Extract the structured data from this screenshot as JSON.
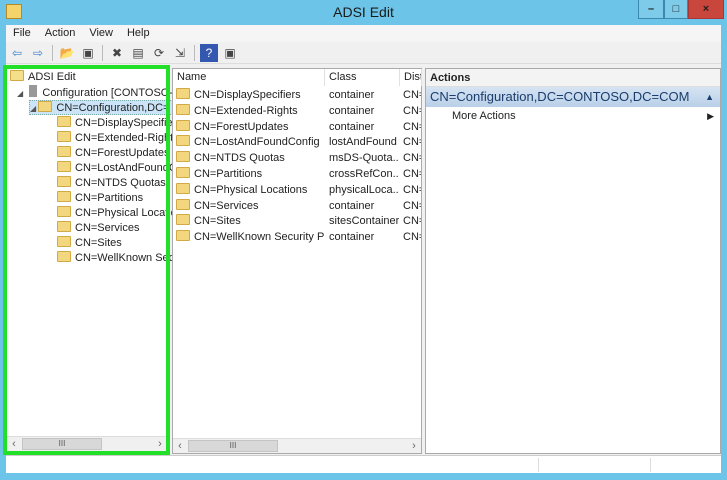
{
  "window": {
    "title": "ADSI Edit",
    "minimize": "–",
    "maximize": "□",
    "close": "×"
  },
  "menu": [
    "File",
    "Action",
    "View",
    "Help"
  ],
  "toolbar": [
    {
      "name": "back-icon",
      "glyph": "⇦"
    },
    {
      "name": "forward-icon",
      "glyph": "⇨"
    },
    {
      "name": "up-folder-icon",
      "glyph": "📂"
    },
    {
      "name": "show-hide-tree-icon",
      "glyph": "▣"
    },
    {
      "name": "delete-icon",
      "glyph": "✖"
    },
    {
      "name": "properties-icon",
      "glyph": "▤"
    },
    {
      "name": "refresh-icon",
      "glyph": "⟳"
    },
    {
      "name": "export-list-icon",
      "glyph": "⇲"
    },
    {
      "name": "help-icon",
      "glyph": "?"
    },
    {
      "name": "show-action-pane-icon",
      "glyph": "▣"
    }
  ],
  "tree": {
    "root": "ADSI Edit",
    "connection": "Configuration [CONTOSO-D",
    "selected": "CN=Configuration,DC=",
    "children": [
      "CN=DisplaySpecifier",
      "CN=Extended-Rights",
      "CN=ForestUpdates",
      "CN=LostAndFoundC",
      "CN=NTDS Quotas",
      "CN=Partitions",
      "CN=Physical Locatio",
      "CN=Services",
      "CN=Sites",
      "CN=WellKnown Secu"
    ]
  },
  "list": {
    "columns": [
      "Name",
      "Class",
      "Disti"
    ],
    "rows": [
      [
        "CN=DisplaySpecifiers",
        "container",
        "CN="
      ],
      [
        "CN=Extended-Rights",
        "container",
        "CN="
      ],
      [
        "CN=ForestUpdates",
        "container",
        "CN="
      ],
      [
        "CN=LostAndFoundConfig",
        "lostAndFound",
        "CN="
      ],
      [
        "CN=NTDS Quotas",
        "msDS-Quota...",
        "CN="
      ],
      [
        "CN=Partitions",
        "crossRefCon...",
        "CN="
      ],
      [
        "CN=Physical Locations",
        "physicalLoca...",
        "CN="
      ],
      [
        "CN=Services",
        "container",
        "CN="
      ],
      [
        "CN=Sites",
        "sitesContainer",
        "CN="
      ],
      [
        "CN=WellKnown Security Pri...",
        "container",
        "CN="
      ]
    ]
  },
  "actions": {
    "header": "Actions",
    "section": "CN=Configuration,DC=CONTOSO,DC=COM",
    "items": [
      "More Actions"
    ]
  },
  "scroll": {
    "left": "‹",
    "right": "›",
    "grip": "III"
  },
  "colors": {
    "accent": "#6cc4e8",
    "highlight": "#22e028",
    "selection": "#cce4f7",
    "close": "#c9463d"
  }
}
